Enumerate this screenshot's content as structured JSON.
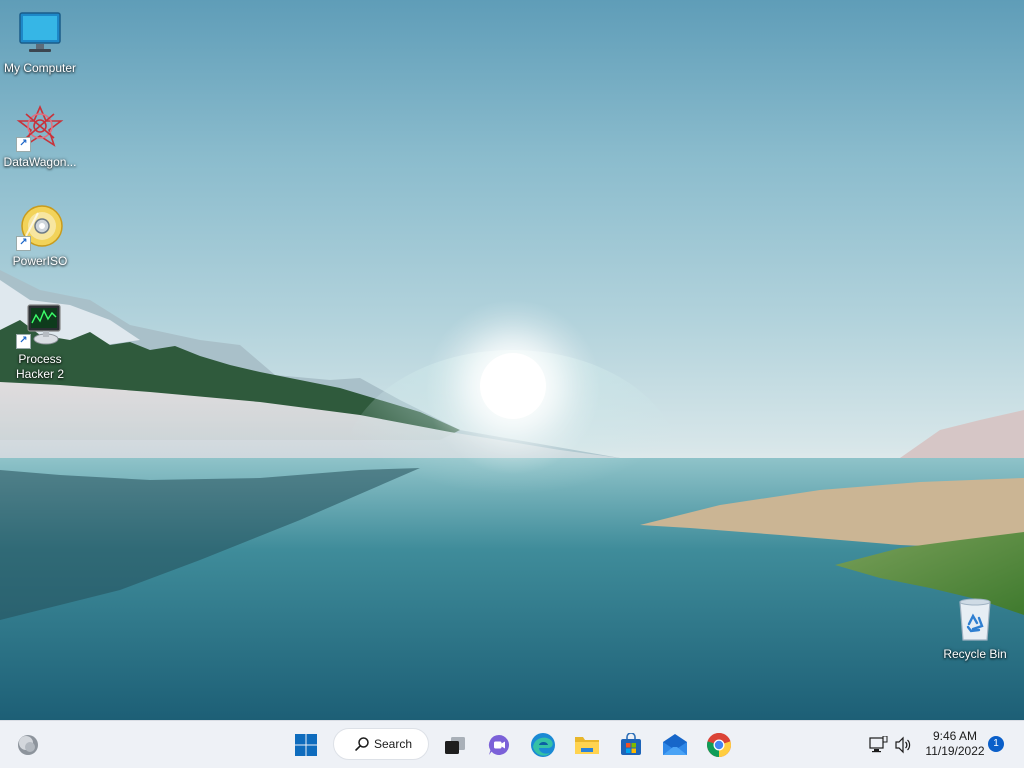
{
  "desktop": {
    "icons": [
      {
        "label": "My Computer",
        "icon": "monitor-icon",
        "shortcut": false
      },
      {
        "label": "DataWagon...",
        "icon": "datawagon-icon",
        "shortcut": true
      },
      {
        "label": "PowerISO",
        "icon": "poweriso-disc-icon",
        "shortcut": true
      },
      {
        "label": "Process Hacker 2",
        "icon": "process-hacker-icon",
        "shortcut": true
      },
      {
        "label": "Recycle Bin",
        "icon": "recycle-bin-icon",
        "shortcut": false
      }
    ]
  },
  "taskbar": {
    "widgets_icon": "weather-widget-icon",
    "search_label": "Search",
    "pinned": [
      {
        "name": "start",
        "icon": "windows-logo-icon"
      },
      {
        "name": "task-view",
        "icon": "task-view-icon"
      },
      {
        "name": "teams-chat",
        "icon": "chat-icon"
      },
      {
        "name": "edge",
        "icon": "edge-icon"
      },
      {
        "name": "file-explorer",
        "icon": "folder-icon"
      },
      {
        "name": "store",
        "icon": "store-icon"
      },
      {
        "name": "mail",
        "icon": "mail-icon"
      },
      {
        "name": "chrome",
        "icon": "chrome-icon"
      }
    ],
    "tray": {
      "network_icon": "network-icon",
      "volume_icon": "volume-icon",
      "time": "9:46 AM",
      "date": "11/19/2022",
      "notification_count": "1"
    }
  },
  "colors": {
    "accent": "#0a5fc9",
    "taskbar_bg": "#eef1f6"
  }
}
